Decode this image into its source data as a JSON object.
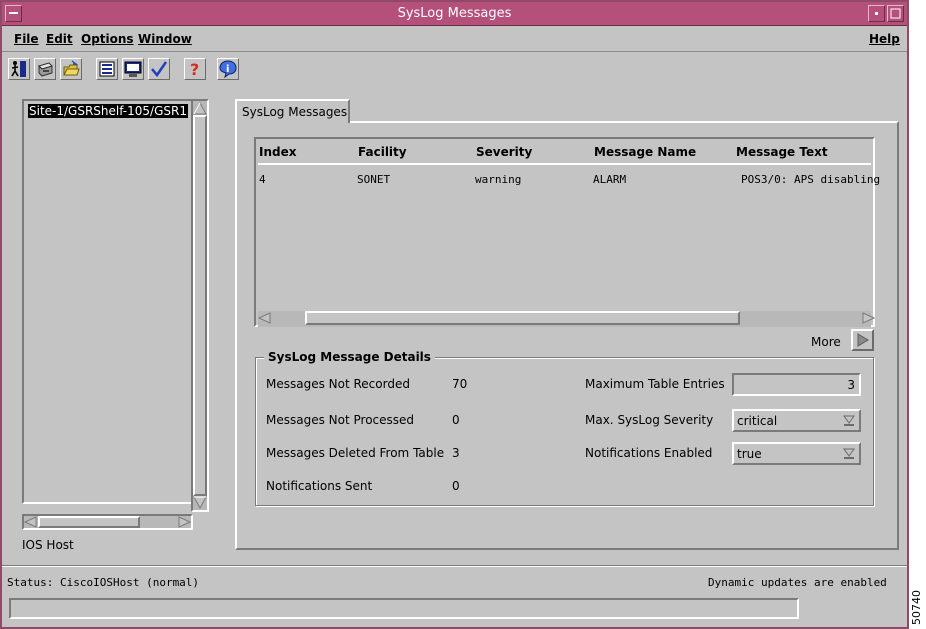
{
  "window": {
    "title": "SysLog Messages",
    "title_bar_color": "#b4507a"
  },
  "menu": {
    "file": "File",
    "edit": "Edit",
    "options": "Options",
    "window": "Window",
    "help": "Help"
  },
  "toolbar": {
    "icons": [
      "exit-icon",
      "print-icon",
      "open-folder-icon",
      "list-icon",
      "monitor-icon",
      "checkmark-icon",
      "question-icon",
      "info-icon"
    ]
  },
  "tree": {
    "selected_node": "Site-1/GSRShelf-105/GSR1",
    "footer_label": "IOS Host"
  },
  "tab": {
    "label": "SysLog Messages"
  },
  "table": {
    "columns": [
      "Index",
      "Facility",
      "Severity",
      "Message Name",
      "Message Text"
    ],
    "rows": [
      {
        "index": "4",
        "facility": "SONET",
        "severity": "warning",
        "message_name": "ALARM",
        "message_text": "POS3/0: APS disabling"
      }
    ]
  },
  "more": {
    "label": "More"
  },
  "details": {
    "title": "SysLog Message Details",
    "not_recorded_label": "Messages Not Recorded",
    "not_recorded_value": "70",
    "not_processed_label": "Messages Not Processed",
    "not_processed_value": "0",
    "deleted_label": "Messages Deleted From Table",
    "deleted_value": "3",
    "notifications_sent_label": "Notifications Sent",
    "notifications_sent_value": "0",
    "max_entries_label": "Maximum Table Entries",
    "max_entries_value": "3",
    "max_severity_label": "Max. SysLog Severity",
    "max_severity_value": "critical",
    "notifications_enabled_label": "Notifications Enabled",
    "notifications_enabled_value": "true"
  },
  "status": {
    "text": "Status: CiscoIOSHost (normal)",
    "updates": "Dynamic updates are enabled"
  },
  "figure_number": "50740"
}
